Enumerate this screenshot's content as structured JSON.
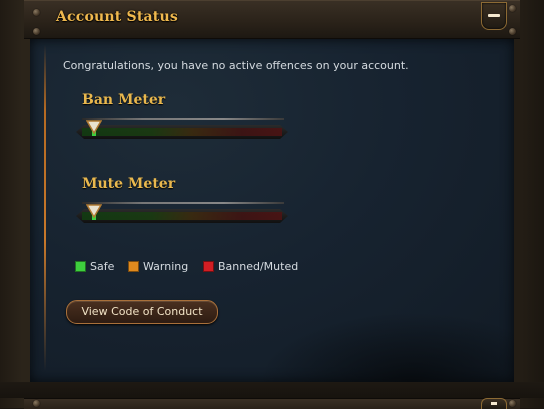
{
  "header": {
    "title": "Account Status",
    "collapse_icon": "minus-icon"
  },
  "status": {
    "message": "Congratulations, you have no active offences on your account."
  },
  "meters": [
    {
      "title": "Ban Meter",
      "level": 0.06,
      "pointer_icon": "down-triangle-icon"
    },
    {
      "title": "Mute Meter",
      "level": 0.06,
      "pointer_icon": "down-triangle-icon"
    }
  ],
  "legend": [
    {
      "label": "Safe",
      "color": "#3ecf3e"
    },
    {
      "label": "Warning",
      "color": "#e08a1e"
    },
    {
      "label": "Banned/Muted",
      "color": "#d21e24"
    }
  ],
  "actions": {
    "conduct_label": "View Code of Conduct"
  },
  "colors": {
    "accent_gold": "#f0b94e",
    "panel_blue": "#172330",
    "frame_brown": "#2a2219"
  }
}
